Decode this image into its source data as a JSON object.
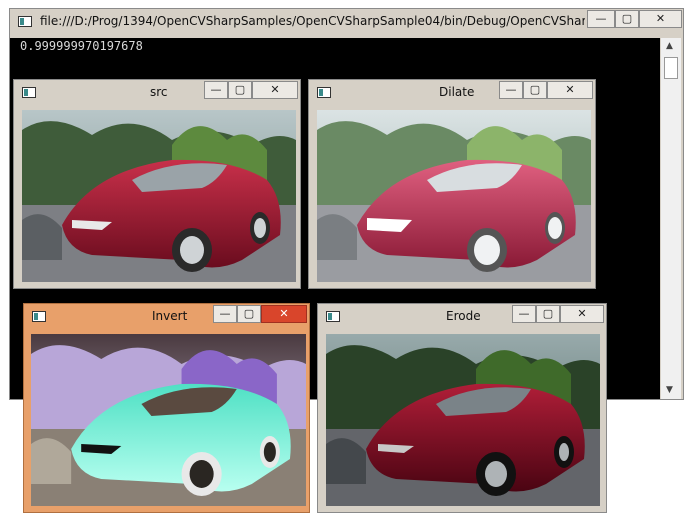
{
  "console": {
    "title": "file:///D:/Prog/1394/OpenCVSharpSamples/OpenCVSharpSample04/bin/Debug/OpenCVSharpSampl...",
    "output": "0.999999970197678",
    "minimize": "—",
    "maximize": "▢",
    "close": "✕"
  },
  "windows": {
    "src": {
      "title": "src"
    },
    "dilate": {
      "title": "Dilate"
    },
    "invert": {
      "title": "Invert"
    },
    "erode": {
      "title": "Erode"
    }
  },
  "icons": {
    "app": "window-icon",
    "scroll_up": "chevron-up-icon",
    "scroll_down": "chevron-down-icon"
  }
}
